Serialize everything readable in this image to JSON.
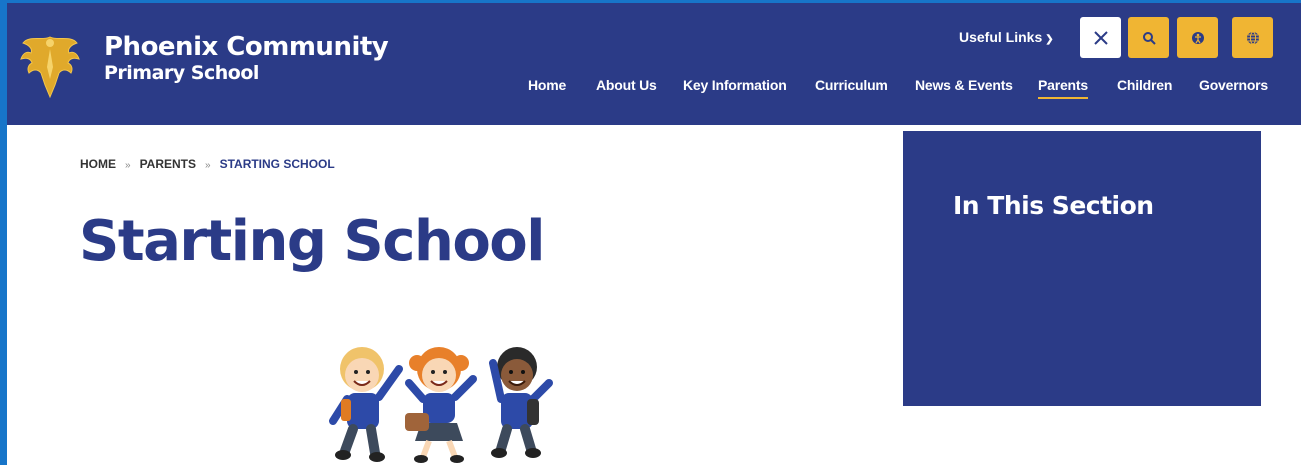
{
  "school": {
    "name_line1": "Phoenix Community",
    "name_line2": "Primary School"
  },
  "top_links": {
    "useful_links": "Useful Links",
    "chevron": "chevron-down-icon"
  },
  "icon_buttons": [
    "x-twitter-icon",
    "search-icon",
    "accessibility-icon",
    "translate-globe-icon"
  ],
  "nav": {
    "items": [
      {
        "label": "Home"
      },
      {
        "label": "About Us"
      },
      {
        "label": "Key Information"
      },
      {
        "label": "Curriculum"
      },
      {
        "label": "News & Events"
      },
      {
        "label": "Parents",
        "active": true
      },
      {
        "label": "Children"
      },
      {
        "label": "Governors"
      }
    ]
  },
  "breadcrumb": {
    "home": "Home",
    "parents": "Parents",
    "current": "Starting School",
    "separator": "»"
  },
  "page": {
    "title": "Starting School"
  },
  "sidebar": {
    "title": "In This Section"
  },
  "colors": {
    "brand": "#2b3b87",
    "accent": "#f0b533",
    "frame": "#1775c9"
  }
}
